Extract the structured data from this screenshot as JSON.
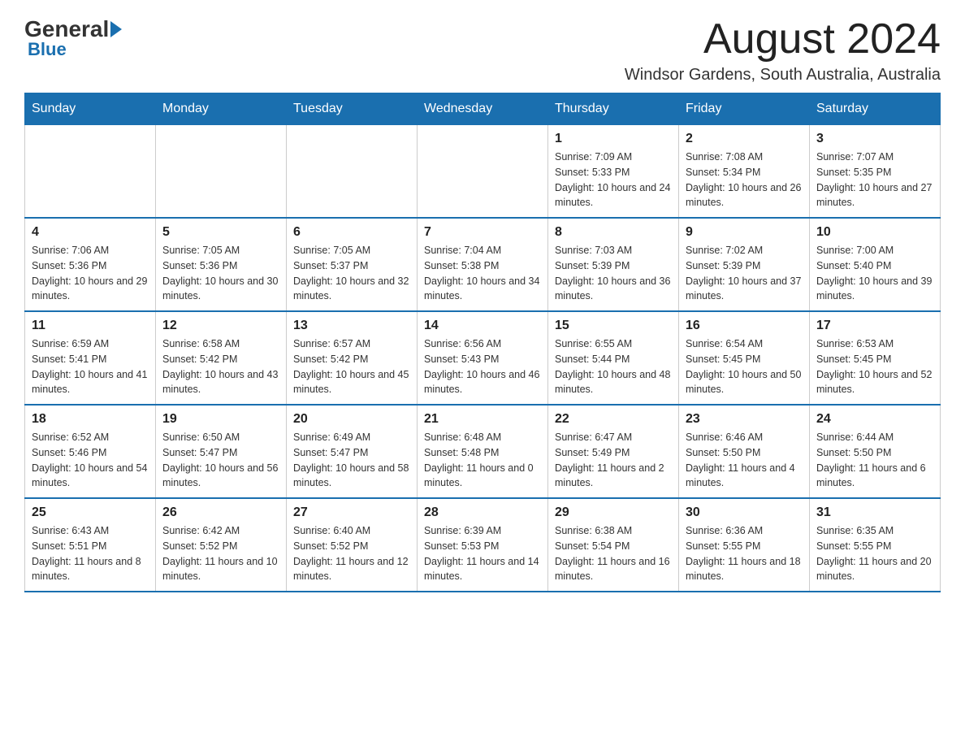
{
  "logo": {
    "general": "General",
    "blue": "Blue"
  },
  "header": {
    "month": "August 2024",
    "location": "Windsor Gardens, South Australia, Australia"
  },
  "days_of_week": [
    "Sunday",
    "Monday",
    "Tuesday",
    "Wednesday",
    "Thursday",
    "Friday",
    "Saturday"
  ],
  "weeks": [
    [
      {
        "day": "",
        "sunrise": "",
        "sunset": "",
        "daylight": ""
      },
      {
        "day": "",
        "sunrise": "",
        "sunset": "",
        "daylight": ""
      },
      {
        "day": "",
        "sunrise": "",
        "sunset": "",
        "daylight": ""
      },
      {
        "day": "",
        "sunrise": "",
        "sunset": "",
        "daylight": ""
      },
      {
        "day": "1",
        "sunrise": "Sunrise: 7:09 AM",
        "sunset": "Sunset: 5:33 PM",
        "daylight": "Daylight: 10 hours and 24 minutes."
      },
      {
        "day": "2",
        "sunrise": "Sunrise: 7:08 AM",
        "sunset": "Sunset: 5:34 PM",
        "daylight": "Daylight: 10 hours and 26 minutes."
      },
      {
        "day": "3",
        "sunrise": "Sunrise: 7:07 AM",
        "sunset": "Sunset: 5:35 PM",
        "daylight": "Daylight: 10 hours and 27 minutes."
      }
    ],
    [
      {
        "day": "4",
        "sunrise": "Sunrise: 7:06 AM",
        "sunset": "Sunset: 5:36 PM",
        "daylight": "Daylight: 10 hours and 29 minutes."
      },
      {
        "day": "5",
        "sunrise": "Sunrise: 7:05 AM",
        "sunset": "Sunset: 5:36 PM",
        "daylight": "Daylight: 10 hours and 30 minutes."
      },
      {
        "day": "6",
        "sunrise": "Sunrise: 7:05 AM",
        "sunset": "Sunset: 5:37 PM",
        "daylight": "Daylight: 10 hours and 32 minutes."
      },
      {
        "day": "7",
        "sunrise": "Sunrise: 7:04 AM",
        "sunset": "Sunset: 5:38 PM",
        "daylight": "Daylight: 10 hours and 34 minutes."
      },
      {
        "day": "8",
        "sunrise": "Sunrise: 7:03 AM",
        "sunset": "Sunset: 5:39 PM",
        "daylight": "Daylight: 10 hours and 36 minutes."
      },
      {
        "day": "9",
        "sunrise": "Sunrise: 7:02 AM",
        "sunset": "Sunset: 5:39 PM",
        "daylight": "Daylight: 10 hours and 37 minutes."
      },
      {
        "day": "10",
        "sunrise": "Sunrise: 7:00 AM",
        "sunset": "Sunset: 5:40 PM",
        "daylight": "Daylight: 10 hours and 39 minutes."
      }
    ],
    [
      {
        "day": "11",
        "sunrise": "Sunrise: 6:59 AM",
        "sunset": "Sunset: 5:41 PM",
        "daylight": "Daylight: 10 hours and 41 minutes."
      },
      {
        "day": "12",
        "sunrise": "Sunrise: 6:58 AM",
        "sunset": "Sunset: 5:42 PM",
        "daylight": "Daylight: 10 hours and 43 minutes."
      },
      {
        "day": "13",
        "sunrise": "Sunrise: 6:57 AM",
        "sunset": "Sunset: 5:42 PM",
        "daylight": "Daylight: 10 hours and 45 minutes."
      },
      {
        "day": "14",
        "sunrise": "Sunrise: 6:56 AM",
        "sunset": "Sunset: 5:43 PM",
        "daylight": "Daylight: 10 hours and 46 minutes."
      },
      {
        "day": "15",
        "sunrise": "Sunrise: 6:55 AM",
        "sunset": "Sunset: 5:44 PM",
        "daylight": "Daylight: 10 hours and 48 minutes."
      },
      {
        "day": "16",
        "sunrise": "Sunrise: 6:54 AM",
        "sunset": "Sunset: 5:45 PM",
        "daylight": "Daylight: 10 hours and 50 minutes."
      },
      {
        "day": "17",
        "sunrise": "Sunrise: 6:53 AM",
        "sunset": "Sunset: 5:45 PM",
        "daylight": "Daylight: 10 hours and 52 minutes."
      }
    ],
    [
      {
        "day": "18",
        "sunrise": "Sunrise: 6:52 AM",
        "sunset": "Sunset: 5:46 PM",
        "daylight": "Daylight: 10 hours and 54 minutes."
      },
      {
        "day": "19",
        "sunrise": "Sunrise: 6:50 AM",
        "sunset": "Sunset: 5:47 PM",
        "daylight": "Daylight: 10 hours and 56 minutes."
      },
      {
        "day": "20",
        "sunrise": "Sunrise: 6:49 AM",
        "sunset": "Sunset: 5:47 PM",
        "daylight": "Daylight: 10 hours and 58 minutes."
      },
      {
        "day": "21",
        "sunrise": "Sunrise: 6:48 AM",
        "sunset": "Sunset: 5:48 PM",
        "daylight": "Daylight: 11 hours and 0 minutes."
      },
      {
        "day": "22",
        "sunrise": "Sunrise: 6:47 AM",
        "sunset": "Sunset: 5:49 PM",
        "daylight": "Daylight: 11 hours and 2 minutes."
      },
      {
        "day": "23",
        "sunrise": "Sunrise: 6:46 AM",
        "sunset": "Sunset: 5:50 PM",
        "daylight": "Daylight: 11 hours and 4 minutes."
      },
      {
        "day": "24",
        "sunrise": "Sunrise: 6:44 AM",
        "sunset": "Sunset: 5:50 PM",
        "daylight": "Daylight: 11 hours and 6 minutes."
      }
    ],
    [
      {
        "day": "25",
        "sunrise": "Sunrise: 6:43 AM",
        "sunset": "Sunset: 5:51 PM",
        "daylight": "Daylight: 11 hours and 8 minutes."
      },
      {
        "day": "26",
        "sunrise": "Sunrise: 6:42 AM",
        "sunset": "Sunset: 5:52 PM",
        "daylight": "Daylight: 11 hours and 10 minutes."
      },
      {
        "day": "27",
        "sunrise": "Sunrise: 6:40 AM",
        "sunset": "Sunset: 5:52 PM",
        "daylight": "Daylight: 11 hours and 12 minutes."
      },
      {
        "day": "28",
        "sunrise": "Sunrise: 6:39 AM",
        "sunset": "Sunset: 5:53 PM",
        "daylight": "Daylight: 11 hours and 14 minutes."
      },
      {
        "day": "29",
        "sunrise": "Sunrise: 6:38 AM",
        "sunset": "Sunset: 5:54 PM",
        "daylight": "Daylight: 11 hours and 16 minutes."
      },
      {
        "day": "30",
        "sunrise": "Sunrise: 6:36 AM",
        "sunset": "Sunset: 5:55 PM",
        "daylight": "Daylight: 11 hours and 18 minutes."
      },
      {
        "day": "31",
        "sunrise": "Sunrise: 6:35 AM",
        "sunset": "Sunset: 5:55 PM",
        "daylight": "Daylight: 11 hours and 20 minutes."
      }
    ]
  ]
}
